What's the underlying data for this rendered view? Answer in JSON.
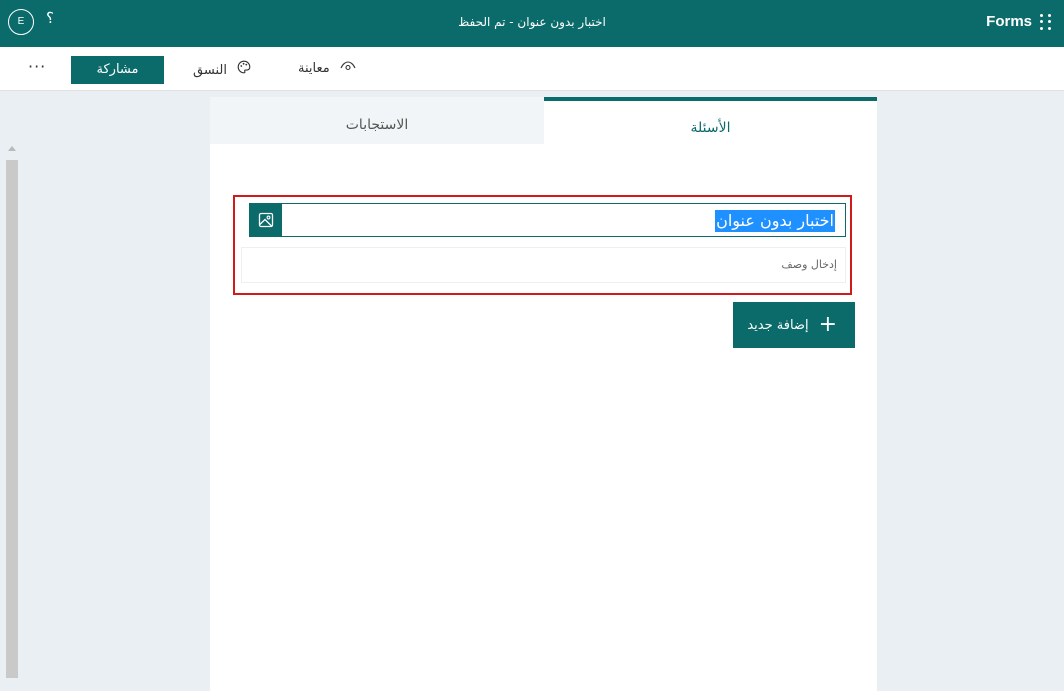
{
  "app": {
    "brand": "Forms",
    "title": "اختبار بدون عنوان - تم الحفظ",
    "avatar_initial": "E",
    "help_glyph": "؟"
  },
  "toolbar": {
    "more_label": "···",
    "share_label": "مشاركة",
    "theme_label": "النسق",
    "theme_icon": "theme-icon",
    "preview_label": "معاينة",
    "preview_icon": "eye-icon"
  },
  "tabs": {
    "questions": "الأسئلة",
    "responses": "الاستجابات"
  },
  "form": {
    "title_value": "اختبار بدون عنوان",
    "description_placeholder": "إدخال وصف",
    "add_new_label": "إضافة جديد",
    "image_icon": "image-icon"
  },
  "colors": {
    "accent": "#0b6a6a",
    "selection": "#1e90ff",
    "highlight_border": "#d11a1a"
  }
}
